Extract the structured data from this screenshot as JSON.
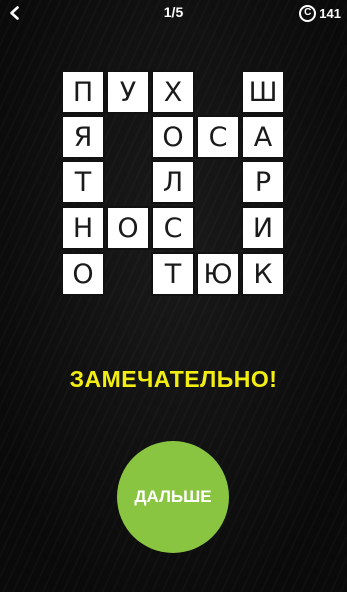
{
  "header": {
    "back_icon": "chevron-left-icon",
    "level": "1/5",
    "coin_symbol": "C",
    "coins": "141"
  },
  "board": {
    "rows": [
      [
        "П",
        "У",
        "Х",
        "",
        "Ш"
      ],
      [
        "Я",
        "",
        "О",
        "С",
        "А"
      ],
      [
        "Т",
        "",
        "Л",
        "",
        "Р"
      ],
      [
        "Н",
        "О",
        "С",
        "",
        "И"
      ],
      [
        "О",
        "",
        "Т",
        "Ю",
        "К"
      ]
    ]
  },
  "message": "ЗАМЕЧАТЕЛЬНО!",
  "next_button": "ДАЛЬШЕ",
  "colors": {
    "background": "#0d0d0d",
    "cell": "#ffffff",
    "letter": "#1a1a1a",
    "message": "#f3ee12",
    "button": "#8ac542"
  }
}
